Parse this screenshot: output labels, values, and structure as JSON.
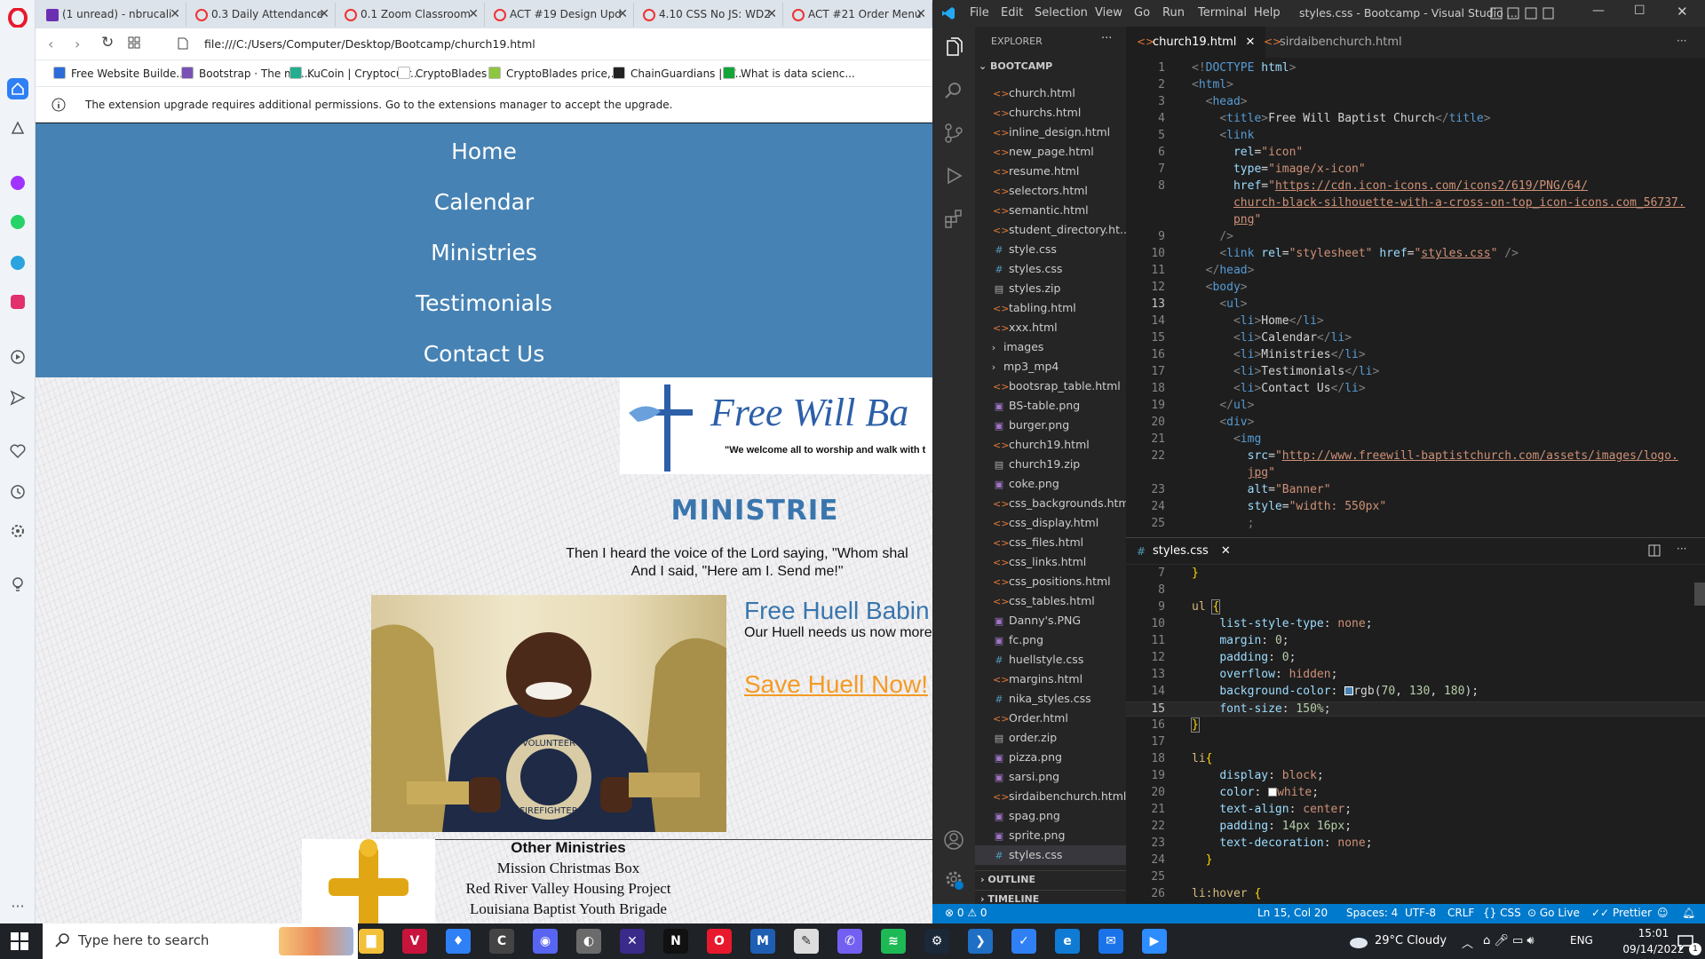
{
  "browser": {
    "tabs": [
      {
        "label": "(1 unread) - nbrucali"
      },
      {
        "label": "0.3 Daily Attendance"
      },
      {
        "label": "0.1 Zoom Classroom"
      },
      {
        "label": "ACT #19 Design Upd"
      },
      {
        "label": "4.10 CSS No JS: WD2"
      },
      {
        "label": "ACT #21 Order Menu"
      }
    ],
    "url": "file:///C:/Users/Computer/Desktop/Bootcamp/church19.html",
    "bookmarks": [
      {
        "label": "Free Website Builde...",
        "color": "#2b6cd9"
      },
      {
        "label": "Bootstrap · The mo...",
        "color": "#7952b3"
      },
      {
        "label": "KuCoin | Cryptocurr...",
        "color": "#24ae8f"
      },
      {
        "label": "CryptoBlades",
        "color": "#ffffff"
      },
      {
        "label": "CryptoBlades price,...",
        "color": "#8dc63f"
      },
      {
        "label": "ChainGuardians | W...",
        "color": "#222222"
      },
      {
        "label": "What is data scienc...",
        "color": "#13a538"
      }
    ],
    "notice": "The extension upgrade requires additional permissions. Go to the extensions manager to accept the upgrade."
  },
  "church_page": {
    "nav": [
      "Home",
      "Calendar",
      "Ministries",
      "Testimonials",
      "Contact Us"
    ],
    "nav_color": "#4682b4",
    "banner_title": "Free Will Ba",
    "banner_tagline": "\"We welcome all to worship and walk with t",
    "ministries_title": "MINISTRIE",
    "verse_line1": "Then I heard the voice of the Lord saying, \"Whom shal",
    "verse_line2": "And I said, \"Here am I. Send me!\"",
    "huell_heading": "Free Huell Babin",
    "huell_desc": "Our Huell needs us now more",
    "save_link": "Save Huell Now!",
    "tshirt_top": "VOLUNTEER",
    "tshirt_bottom": "FIREFIGHTER",
    "other_title": "Other Ministries",
    "other_items": [
      "Mission Christmas Box",
      "Red River Valley Housing Project",
      "Louisiana Baptist Youth Brigade"
    ]
  },
  "vscode": {
    "menu": [
      "File",
      "Edit",
      "Selection",
      "View",
      "Go",
      "Run",
      "Terminal",
      "Help"
    ],
    "window_title": "styles.css - Bootcamp - Visual Studio ...",
    "explorer_label": "EXPLORER",
    "folder": "BOOTCAMP",
    "files": [
      {
        "name": "church.html",
        "type": "html"
      },
      {
        "name": "churchs.html",
        "type": "html"
      },
      {
        "name": "inline_design.html",
        "type": "html"
      },
      {
        "name": "new_page.html",
        "type": "html"
      },
      {
        "name": "resume.html",
        "type": "html"
      },
      {
        "name": "selectors.html",
        "type": "html"
      },
      {
        "name": "semantic.html",
        "type": "html"
      },
      {
        "name": "student_directory.ht...",
        "type": "html"
      },
      {
        "name": "style.css",
        "type": "css"
      },
      {
        "name": "styles.css",
        "type": "css"
      },
      {
        "name": "styles.zip",
        "type": "zip"
      },
      {
        "name": "tabling.html",
        "type": "html"
      },
      {
        "name": "xxx.html",
        "type": "html"
      },
      {
        "name": "images",
        "type": "folder"
      },
      {
        "name": "mp3_mp4",
        "type": "folder"
      },
      {
        "name": "bootsrap_table.html",
        "type": "html"
      },
      {
        "name": "BS-table.png",
        "type": "png"
      },
      {
        "name": "burger.png",
        "type": "png"
      },
      {
        "name": "church19.html",
        "type": "html"
      },
      {
        "name": "church19.zip",
        "type": "zip"
      },
      {
        "name": "coke.png",
        "type": "png"
      },
      {
        "name": "css_backgrounds.html",
        "type": "html"
      },
      {
        "name": "css_display.html",
        "type": "html"
      },
      {
        "name": "css_files.html",
        "type": "html"
      },
      {
        "name": "css_links.html",
        "type": "html"
      },
      {
        "name": "css_positions.html",
        "type": "html"
      },
      {
        "name": "css_tables.html",
        "type": "html"
      },
      {
        "name": "Danny's.PNG",
        "type": "png"
      },
      {
        "name": "fc.png",
        "type": "png"
      },
      {
        "name": "huellstyle.css",
        "type": "css"
      },
      {
        "name": "margins.html",
        "type": "html"
      },
      {
        "name": "nika_styles.css",
        "type": "css"
      },
      {
        "name": "Order.html",
        "type": "html"
      },
      {
        "name": "order.zip",
        "type": "zip"
      },
      {
        "name": "pizza.png",
        "type": "png"
      },
      {
        "name": "sarsi.png",
        "type": "png"
      },
      {
        "name": "sirdaibenchurch.html",
        "type": "html"
      },
      {
        "name": "spag.png",
        "type": "png"
      },
      {
        "name": "sprite.png",
        "type": "png"
      },
      {
        "name": "styles.css",
        "type": "css"
      }
    ],
    "outline_label": "OUTLINE",
    "timeline_label": "TIMELINE",
    "tabs_top": [
      "church19.html",
      "sirdaibenchurch.html"
    ],
    "tab_bottom": "styles.css",
    "status": {
      "errors": "0",
      "warnings": "0",
      "position": "Ln 15, Col 20",
      "spaces": "Spaces: 4",
      "encoding": "UTF-8",
      "eol": "CRLF",
      "language": "CSS",
      "golive": "Go Live",
      "prettier": "Prettier"
    }
  },
  "taskbar": {
    "search_placeholder": "Type here to search",
    "weather": "29°C  Cloudy",
    "lang": "ENG",
    "time": "15:01",
    "date": "09/14/2022",
    "notifications": "1"
  }
}
